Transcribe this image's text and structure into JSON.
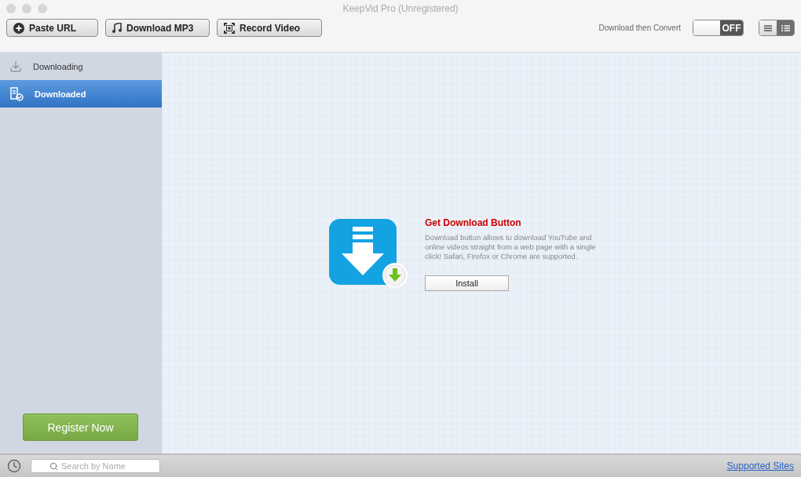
{
  "window": {
    "title": "KeepVid Pro (Unregistered)"
  },
  "toolbar": {
    "buttons": [
      {
        "label": "Paste URL",
        "kind": "paste"
      },
      {
        "label": "Download MP3",
        "kind": "mp3"
      },
      {
        "label": "Record Video",
        "kind": "record"
      }
    ],
    "convert": {
      "label": "Download then Convert",
      "on": false,
      "state_text": "OFF"
    },
    "view_modes": [
      {
        "kind": "list",
        "selected": false
      },
      {
        "kind": "detail",
        "selected": true
      }
    ]
  },
  "sidebar": {
    "items": [
      {
        "label": "Downloading",
        "kind": "downloading",
        "selected": false
      },
      {
        "label": "Downloaded",
        "kind": "downloaded",
        "selected": true
      }
    ],
    "register_button": "Register Now"
  },
  "promo": {
    "title": "Get Download Button",
    "description": "Download button allows to download YouTube and online videos straight from a web page with a single click! Safari, Firefox or Chrome are supported.",
    "button": "Install"
  },
  "footer": {
    "search": {
      "placeholder": "Search by Name"
    },
    "link": "Supported Sites"
  }
}
